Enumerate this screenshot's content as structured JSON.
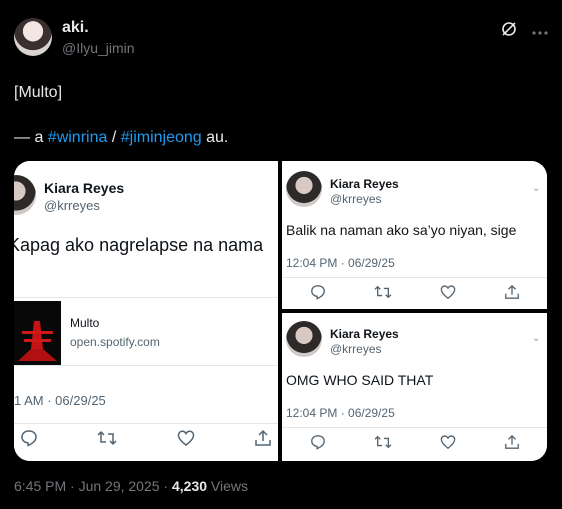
{
  "author": {
    "display_name": "aki.",
    "handle": "@Ilyu_jimin"
  },
  "tweet": {
    "line1": "[Multo]",
    "line2_prefix": "— a ",
    "hashtag1": "#winrina",
    "separator": " / ",
    "hashtag2": "#jiminjeong",
    "line2_suffix": " au."
  },
  "media": {
    "left": {
      "name": "Kiara Reyes",
      "handle": "@krreyes",
      "text": "Kapag ako nagrelapse na nama",
      "card_title": "Multo",
      "card_domain": "open.spotify.com",
      "time": "1 AM · 06/29/25"
    },
    "right_top": {
      "name": "Kiara Reyes",
      "handle": "@krreyes",
      "text": "Balik na naman ako sa’yo niyan, sige",
      "time": "12:04 PM · 06/29/25"
    },
    "right_bottom": {
      "name": "Kiara Reyes",
      "handle": "@krreyes",
      "text": "OMG WHO SAID THAT",
      "time": "12:04 PM · 06/29/25"
    }
  },
  "footer": {
    "timestamp": "6:45 PM · Jun 29, 2025 · ",
    "views_count": "4,230",
    "views_label": " Views"
  },
  "icons": [
    "grok-icon",
    "more-icon",
    "reply-icon",
    "retweet-icon",
    "like-icon",
    "share-icon",
    "chevron-down-icon"
  ],
  "colors": {
    "background": "#000000",
    "link": "#1d9bf0",
    "muted": "#71767b"
  }
}
